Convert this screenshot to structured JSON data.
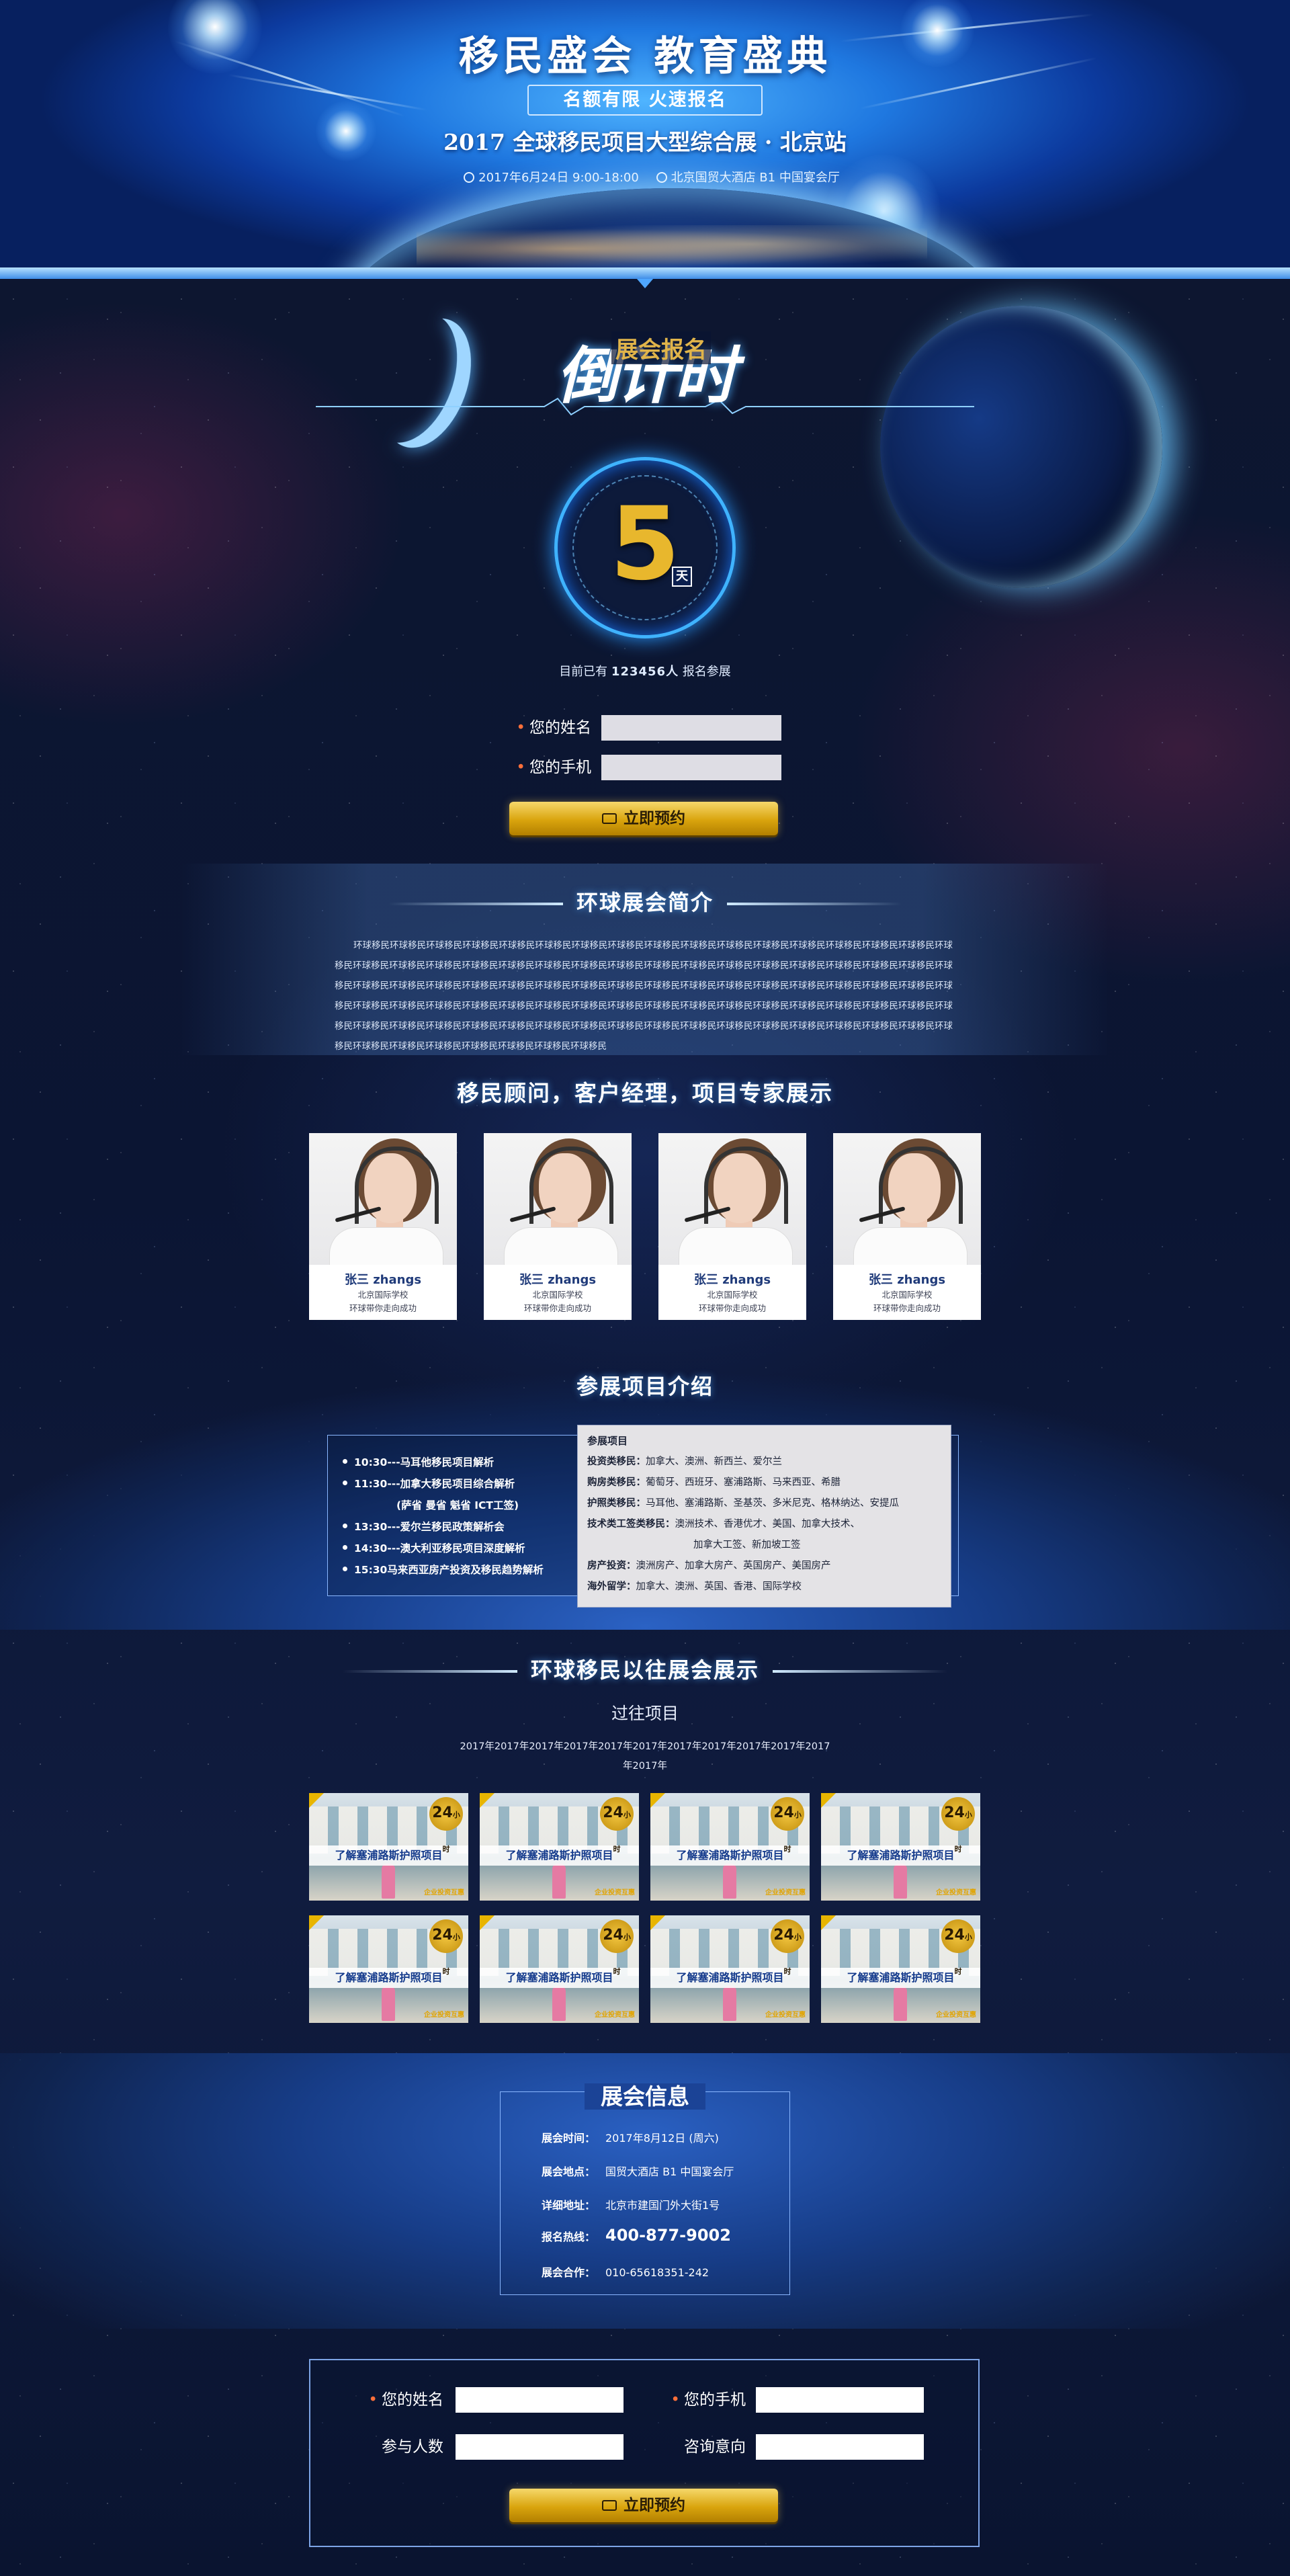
{
  "header": {
    "title": "移民盛会 教育盛典",
    "tagline": "名额有限 火速报名",
    "event_title": "2017 全球移民项目大型综合展 · 北京站",
    "datetime": "2017年6月24日 9:00-18:00",
    "venue": "北京国贸大酒店 B1 中国宴会厅"
  },
  "countdown": {
    "title_big": "倒计时",
    "title_small": "展会报名",
    "days": "5",
    "unit": "天",
    "reg_prefix": "目前已有",
    "reg_count": "123456人",
    "reg_suffix": "报名参展"
  },
  "top_form": {
    "name_label": "您的姓名",
    "phone_label": "您的手机",
    "name_value": "",
    "phone_value": "",
    "submit_label": "立即预约"
  },
  "intro": {
    "title": "环球展会简介",
    "body": "环球移民环球移民环球移民环球移民环球移民环球移民环球移民环球移民环球移民环球移民环球移民环球移民环球移民环球移民环球移民环球移民环球移民环球移民环球移民环球移民环球移民环球移民环球移民环球移民环球移民环球移民环球移民环球移民环球移民环球移民环球移民环球移民环球移民环球移民环球移民环球移民环球移民环球移民环球移民环球移民环球移民环球移民环球移民环球移民环球移民环球移民环球移民环球移民环球移民环球移民环球移民环球移民环球移民环球移民环球移民环球移民环球移民环球移民环球移民环球移民环球移民环球移民环球移民环球移民环球移民环球移民环球移民环球移民环球移民环球移民环球移民环球移民环球移民环球移民环球移民环球移民环球移民环球移民环球移民环球移民环球移民环球移民环球移民环球移民环球移民环球移民环球移民环球移民环球移民环球移民环球移民环球移民"
  },
  "consultants": {
    "title": "移民顾问，客户经理，项目专家展示",
    "items": [
      {
        "name": "张三 zhangs",
        "line1": "北京国际学校",
        "line2": "环球带你走向成功"
      },
      {
        "name": "张三 zhangs",
        "line1": "北京国际学校",
        "line2": "环球带你走向成功"
      },
      {
        "name": "张三 zhangs",
        "line1": "北京国际学校",
        "line2": "环球带你走向成功"
      },
      {
        "name": "张三 zhangs",
        "line1": "北京国际学校",
        "line2": "环球带你走向成功"
      }
    ]
  },
  "projects": {
    "title": "参展项目介绍",
    "schedule": [
      "10:30---马耳他移民项目解析",
      "11:30---加拿大移民项目综合解析",
      "(萨省 曼省 魁省 ICT工签)",
      "13:30---爱尔兰移民政策解析会",
      "14:30---澳大利亚移民项目深度解析",
      "15:30马来西亚房产投资及移民趋势解析"
    ],
    "detail_heading": "参展项目",
    "details": [
      {
        "k": "投资类移民：",
        "v": "加拿大、澳洲、新西兰、爱尔兰"
      },
      {
        "k": "购房类移民：",
        "v": "葡萄牙、西班牙、塞浦路斯、马来西亚、希腊"
      },
      {
        "k": "护照类移民：",
        "v": "马耳他、塞浦路斯、圣基茨、多米尼克、格林纳达、安提瓜"
      },
      {
        "k": "技术类工签类移民：",
        "v": "澳洲技术、香港优才、美国、加拿大技术、"
      },
      {
        "k": "",
        "v": "加拿大工签、新加坡工签"
      },
      {
        "k": "房产投资：",
        "v": "澳洲房产、加拿大房产、英国房产、美国房产"
      },
      {
        "k": "海外留学：",
        "v": "加拿大、澳洲、英国、香港、国际学校"
      }
    ]
  },
  "past": {
    "title": "环球移民以往展会展示",
    "subtitle": "过往项目",
    "years": "2017年2017年2017年2017年2017年2017年2017年2017年2017年2017年2017年2017年",
    "thumb_caption": "了解塞浦路斯护照项目",
    "thumb_badge": "24",
    "thumb_badge_unit": "小时",
    "thumb_tag": "企业投资互惠"
  },
  "info": {
    "title": "展会信息",
    "rows": [
      {
        "k": "展会时间：",
        "v": "2017年8月12日 (周六)"
      },
      {
        "k": "展会地点：",
        "v": "国贸大酒店 B1 中国宴会厅"
      },
      {
        "k": "详细地址：",
        "v": "北京市建国门外大街1号"
      },
      {
        "k": "报名热线：",
        "v": "400-877-9002"
      },
      {
        "k": "展会合作：",
        "v": "010-65618351-242"
      }
    ]
  },
  "bottom_form": {
    "name_label": "您的姓名",
    "phone_label": "您的手机",
    "count_label": "参与人数",
    "intent_label": "咨询意向",
    "submit_label": "立即预约"
  },
  "colors": {
    "accent_gold": "#e8b72d",
    "header_blue": "#1f78e0",
    "background_navy": "#0d1630"
  }
}
